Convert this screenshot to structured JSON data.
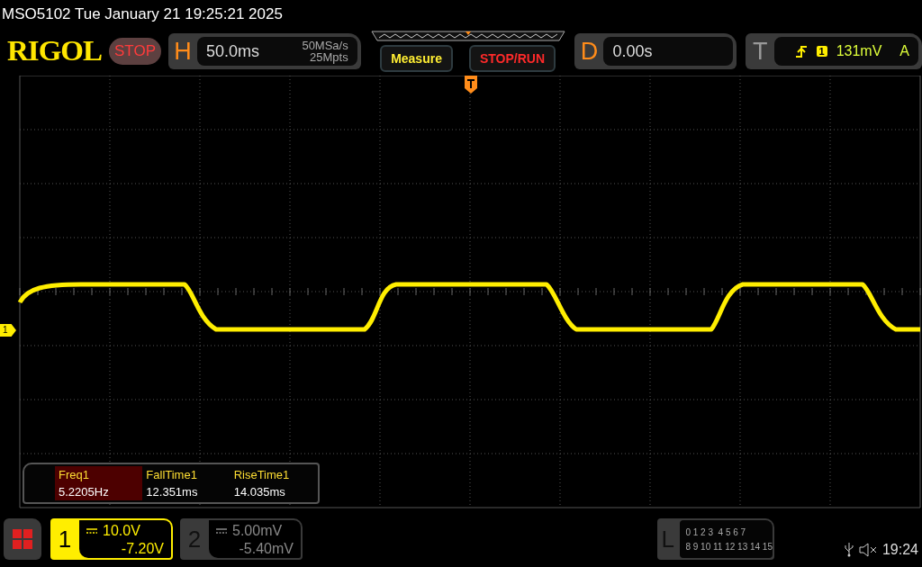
{
  "status_line": "MSO5102  Tue January 21 19:25:21 2025",
  "toolbar": {
    "logo": "RIGOL",
    "run_state": "STOP",
    "horizontal": {
      "letter": "H",
      "timebase": "50.0ms",
      "sample_rate": "50MSa/s",
      "memory_depth": "25Mpts"
    },
    "buttons": [
      {
        "label": "Measure",
        "kind": "measure"
      },
      {
        "label": "STOP/RUN",
        "kind": "run"
      }
    ],
    "delay": {
      "letter": "D",
      "value": "0.00s"
    },
    "trigger": {
      "letter": "T",
      "source": "1",
      "level": "131mV",
      "mode": "A"
    }
  },
  "screen": {
    "channel_marker": "1",
    "measurements": [
      {
        "label": "Freq1",
        "value": "5.2205Hz",
        "selected": true
      },
      {
        "label": "FallTime1",
        "value": "12.351ms",
        "selected": false
      },
      {
        "label": "RiseTime1",
        "value": "14.035ms",
        "selected": false
      }
    ]
  },
  "bottom_bar": {
    "channels": [
      {
        "number": "1",
        "scale": "10.0V",
        "offset": "-7.20V",
        "active": true
      },
      {
        "number": "2",
        "scale": "5.00mV",
        "offset": "-5.40mV",
        "active": false
      }
    ],
    "logic": {
      "letter": "L",
      "rows": [
        "0 1 2 3  4 5 6 7",
        "8 9 10 11 12 13 14 15"
      ]
    },
    "clock": "19:24"
  }
}
